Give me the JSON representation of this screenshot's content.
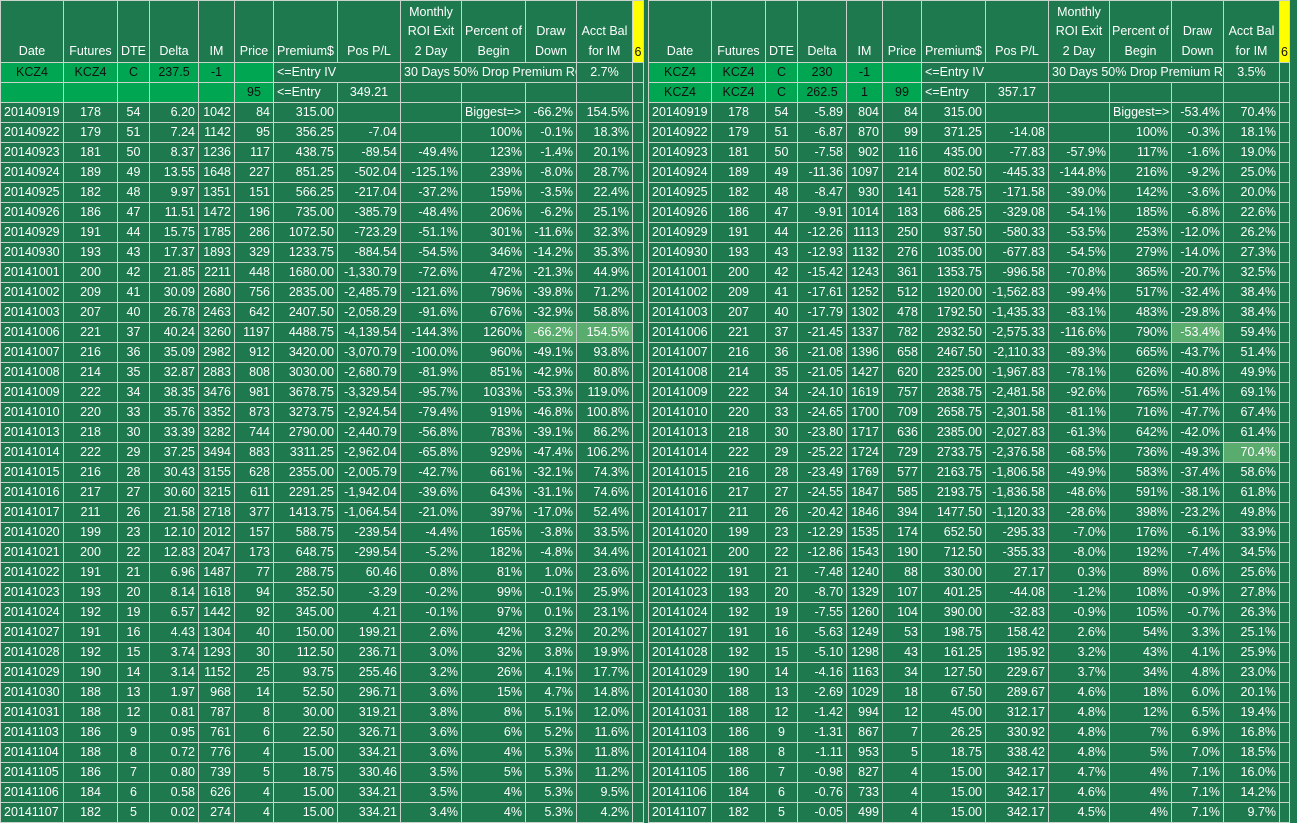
{
  "headers": [
    "Date",
    "Futures",
    "DTE",
    "Delta",
    "IM",
    "Price",
    "Premium$",
    "Pos P/L",
    "Monthly ROI Exit 2 Day",
    "Percent of Begin",
    "Draw Down",
    "Acct Bal for IM",
    "6"
  ],
  "panels": [
    {
      "entry1": [
        "KCZ4",
        "KCZ4",
        "C",
        "237.5",
        "-1"
      ],
      "entry1_note": "<=Entry IV",
      "entry1_roi_label": "30 Days 50% Drop Premium ROI=>",
      "entry1_roi": "2.7%",
      "entry2_price": "95",
      "entry2_note": "<=Entry",
      "entry2_value": "349.21",
      "rows": [
        [
          "20140919",
          "178",
          "54",
          "6.20",
          "1042",
          "84",
          "315.00",
          "",
          "",
          "Biggest=>",
          "-66.2%",
          "154.5%"
        ],
        [
          "20140922",
          "179",
          "51",
          "7.24",
          "1142",
          "95",
          "356.25",
          "-7.04",
          "",
          "100%",
          "-0.1%",
          "18.3%"
        ],
        [
          "20140923",
          "181",
          "50",
          "8.37",
          "1236",
          "117",
          "438.75",
          "-89.54",
          "-49.4%",
          "123%",
          "-1.4%",
          "20.1%"
        ],
        [
          "20140924",
          "189",
          "49",
          "13.55",
          "1648",
          "227",
          "851.25",
          "-502.04",
          "-125.1%",
          "239%",
          "-8.0%",
          "28.7%"
        ],
        [
          "20140925",
          "182",
          "48",
          "9.97",
          "1351",
          "151",
          "566.25",
          "-217.04",
          "-37.2%",
          "159%",
          "-3.5%",
          "22.4%"
        ],
        [
          "20140926",
          "186",
          "47",
          "11.51",
          "1472",
          "196",
          "735.00",
          "-385.79",
          "-48.4%",
          "206%",
          "-6.2%",
          "25.1%"
        ],
        [
          "20140929",
          "191",
          "44",
          "15.75",
          "1785",
          "286",
          "1072.50",
          "-723.29",
          "-51.1%",
          "301%",
          "-11.6%",
          "32.3%"
        ],
        [
          "20140930",
          "193",
          "43",
          "17.37",
          "1893",
          "329",
          "1233.75",
          "-884.54",
          "-54.5%",
          "346%",
          "-14.2%",
          "35.3%"
        ],
        [
          "20141001",
          "200",
          "42",
          "21.85",
          "2211",
          "448",
          "1680.00",
          "-1,330.79",
          "-72.6%",
          "472%",
          "-21.3%",
          "44.9%"
        ],
        [
          "20141002",
          "209",
          "41",
          "30.09",
          "2680",
          "756",
          "2835.00",
          "-2,485.79",
          "-121.6%",
          "796%",
          "-39.8%",
          "71.2%"
        ],
        [
          "20141003",
          "207",
          "40",
          "26.78",
          "2463",
          "642",
          "2407.50",
          "-2,058.29",
          "-91.6%",
          "676%",
          "-32.9%",
          "58.8%"
        ],
        [
          "20141006",
          "221",
          "37",
          "40.24",
          "3260",
          "1197",
          "4488.75",
          "-4,139.54",
          "-144.3%",
          "1260%",
          "-66.2%",
          "154.5%"
        ],
        [
          "20141007",
          "216",
          "36",
          "35.09",
          "2982",
          "912",
          "3420.00",
          "-3,070.79",
          "-100.0%",
          "960%",
          "-49.1%",
          "93.8%"
        ],
        [
          "20141008",
          "214",
          "35",
          "32.87",
          "2883",
          "808",
          "3030.00",
          "-2,680.79",
          "-81.9%",
          "851%",
          "-42.9%",
          "80.8%"
        ],
        [
          "20141009",
          "222",
          "34",
          "38.35",
          "3476",
          "981",
          "3678.75",
          "-3,329.54",
          "-95.7%",
          "1033%",
          "-53.3%",
          "119.0%"
        ],
        [
          "20141010",
          "220",
          "33",
          "35.76",
          "3352",
          "873",
          "3273.75",
          "-2,924.54",
          "-79.4%",
          "919%",
          "-46.8%",
          "100.8%"
        ],
        [
          "20141013",
          "218",
          "30",
          "33.39",
          "3282",
          "744",
          "2790.00",
          "-2,440.79",
          "-56.8%",
          "783%",
          "-39.1%",
          "86.2%"
        ],
        [
          "20141014",
          "222",
          "29",
          "37.25",
          "3494",
          "883",
          "3311.25",
          "-2,962.04",
          "-65.8%",
          "929%",
          "-47.4%",
          "106.2%"
        ],
        [
          "20141015",
          "216",
          "28",
          "30.43",
          "3155",
          "628",
          "2355.00",
          "-2,005.79",
          "-42.7%",
          "661%",
          "-32.1%",
          "74.3%"
        ],
        [
          "20141016",
          "217",
          "27",
          "30.60",
          "3215",
          "611",
          "2291.25",
          "-1,942.04",
          "-39.6%",
          "643%",
          "-31.1%",
          "74.6%"
        ],
        [
          "20141017",
          "211",
          "26",
          "21.58",
          "2718",
          "377",
          "1413.75",
          "-1,064.54",
          "-21.0%",
          "397%",
          "-17.0%",
          "52.4%"
        ],
        [
          "20141020",
          "199",
          "23",
          "12.10",
          "2012",
          "157",
          "588.75",
          "-239.54",
          "-4.4%",
          "165%",
          "-3.8%",
          "33.5%"
        ],
        [
          "20141021",
          "200",
          "22",
          "12.83",
          "2047",
          "173",
          "648.75",
          "-299.54",
          "-5.2%",
          "182%",
          "-4.8%",
          "34.4%"
        ],
        [
          "20141022",
          "191",
          "21",
          "6.96",
          "1487",
          "77",
          "288.75",
          "60.46",
          "0.8%",
          "81%",
          "1.0%",
          "23.6%"
        ],
        [
          "20141023",
          "193",
          "20",
          "8.14",
          "1618",
          "94",
          "352.50",
          "-3.29",
          "-0.2%",
          "99%",
          "-0.1%",
          "25.9%"
        ],
        [
          "20141024",
          "192",
          "19",
          "6.57",
          "1442",
          "92",
          "345.00",
          "4.21",
          "-0.1%",
          "97%",
          "0.1%",
          "23.1%"
        ],
        [
          "20141027",
          "191",
          "16",
          "4.43",
          "1304",
          "40",
          "150.00",
          "199.21",
          "2.6%",
          "42%",
          "3.2%",
          "20.2%"
        ],
        [
          "20141028",
          "192",
          "15",
          "3.74",
          "1293",
          "30",
          "112.50",
          "236.71",
          "3.0%",
          "32%",
          "3.8%",
          "19.9%"
        ],
        [
          "20141029",
          "190",
          "14",
          "3.14",
          "1152",
          "25",
          "93.75",
          "255.46",
          "3.2%",
          "26%",
          "4.1%",
          "17.7%"
        ],
        [
          "20141030",
          "188",
          "13",
          "1.97",
          "968",
          "14",
          "52.50",
          "296.71",
          "3.6%",
          "15%",
          "4.7%",
          "14.8%"
        ],
        [
          "20141031",
          "188",
          "12",
          "0.81",
          "787",
          "8",
          "30.00",
          "319.21",
          "3.8%",
          "8%",
          "5.1%",
          "12.0%"
        ],
        [
          "20141103",
          "186",
          "9",
          "0.95",
          "761",
          "6",
          "22.50",
          "326.71",
          "3.6%",
          "6%",
          "5.2%",
          "11.6%"
        ],
        [
          "20141104",
          "188",
          "8",
          "0.72",
          "776",
          "4",
          "15.00",
          "334.21",
          "3.6%",
          "4%",
          "5.3%",
          "11.8%"
        ],
        [
          "20141105",
          "186",
          "7",
          "0.80",
          "739",
          "5",
          "18.75",
          "330.46",
          "3.5%",
          "5%",
          "5.3%",
          "11.2%"
        ],
        [
          "20141106",
          "184",
          "6",
          "0.58",
          "626",
          "4",
          "15.00",
          "334.21",
          "3.5%",
          "4%",
          "5.3%",
          "9.5%"
        ],
        [
          "20141107",
          "182",
          "5",
          "0.02",
          "274",
          "4",
          "15.00",
          "334.21",
          "3.4%",
          "4%",
          "5.3%",
          "4.2%"
        ]
      ]
    },
    {
      "entry1": [
        "KCZ4",
        "KCZ4",
        "C",
        "230",
        "-1"
      ],
      "entry1_note": "<=Entry IV",
      "entry1_roi_label": "30 Days 50% Drop Premium ROI=>",
      "entry1_roi": "3.5%",
      "entry2": [
        "KCZ4",
        "KCZ4",
        "C",
        "262.5",
        "1"
      ],
      "entry2_price": "99",
      "entry2_note": "<=Entry",
      "entry2_value": "357.17",
      "rows": [
        [
          "20140919",
          "178",
          "54",
          "-5.89",
          "804",
          "84",
          "315.00",
          "",
          "",
          "Biggest=>",
          "-53.4%",
          "70.4%"
        ],
        [
          "20140922",
          "179",
          "51",
          "-6.87",
          "870",
          "99",
          "371.25",
          "-14.08",
          "",
          "100%",
          "-0.3%",
          "18.1%"
        ],
        [
          "20140923",
          "181",
          "50",
          "-7.58",
          "902",
          "116",
          "435.00",
          "-77.83",
          "-57.9%",
          "117%",
          "-1.6%",
          "19.0%"
        ],
        [
          "20140924",
          "189",
          "49",
          "-11.36",
          "1097",
          "214",
          "802.50",
          "-445.33",
          "-144.8%",
          "216%",
          "-9.2%",
          "25.0%"
        ],
        [
          "20140925",
          "182",
          "48",
          "-8.47",
          "930",
          "141",
          "528.75",
          "-171.58",
          "-39.0%",
          "142%",
          "-3.6%",
          "20.0%"
        ],
        [
          "20140926",
          "186",
          "47",
          "-9.91",
          "1014",
          "183",
          "686.25",
          "-329.08",
          "-54.1%",
          "185%",
          "-6.8%",
          "22.6%"
        ],
        [
          "20140929",
          "191",
          "44",
          "-12.26",
          "1113",
          "250",
          "937.50",
          "-580.33",
          "-53.5%",
          "253%",
          "-12.0%",
          "26.2%"
        ],
        [
          "20140930",
          "193",
          "43",
          "-12.93",
          "1132",
          "276",
          "1035.00",
          "-677.83",
          "-54.5%",
          "279%",
          "-14.0%",
          "27.3%"
        ],
        [
          "20141001",
          "200",
          "42",
          "-15.42",
          "1243",
          "361",
          "1353.75",
          "-996.58",
          "-70.8%",
          "365%",
          "-20.7%",
          "32.5%"
        ],
        [
          "20141002",
          "209",
          "41",
          "-17.61",
          "1252",
          "512",
          "1920.00",
          "-1,562.83",
          "-99.4%",
          "517%",
          "-32.4%",
          "38.4%"
        ],
        [
          "20141003",
          "207",
          "40",
          "-17.79",
          "1302",
          "478",
          "1792.50",
          "-1,435.33",
          "-83.1%",
          "483%",
          "-29.8%",
          "38.4%"
        ],
        [
          "20141006",
          "221",
          "37",
          "-21.45",
          "1337",
          "782",
          "2932.50",
          "-2,575.33",
          "-116.6%",
          "790%",
          "-53.4%",
          "59.4%"
        ],
        [
          "20141007",
          "216",
          "36",
          "-21.08",
          "1396",
          "658",
          "2467.50",
          "-2,110.33",
          "-89.3%",
          "665%",
          "-43.7%",
          "51.4%"
        ],
        [
          "20141008",
          "214",
          "35",
          "-21.05",
          "1427",
          "620",
          "2325.00",
          "-1,967.83",
          "-78.1%",
          "626%",
          "-40.8%",
          "49.9%"
        ],
        [
          "20141009",
          "222",
          "34",
          "-24.10",
          "1619",
          "757",
          "2838.75",
          "-2,481.58",
          "-92.6%",
          "765%",
          "-51.4%",
          "69.1%"
        ],
        [
          "20141010",
          "220",
          "33",
          "-24.65",
          "1700",
          "709",
          "2658.75",
          "-2,301.58",
          "-81.1%",
          "716%",
          "-47.7%",
          "67.4%"
        ],
        [
          "20141013",
          "218",
          "30",
          "-23.80",
          "1717",
          "636",
          "2385.00",
          "-2,027.83",
          "-61.3%",
          "642%",
          "-42.0%",
          "61.4%"
        ],
        [
          "20141014",
          "222",
          "29",
          "-25.22",
          "1724",
          "729",
          "2733.75",
          "-2,376.58",
          "-68.5%",
          "736%",
          "-49.3%",
          "70.4%"
        ],
        [
          "20141015",
          "216",
          "28",
          "-23.49",
          "1769",
          "577",
          "2163.75",
          "-1,806.58",
          "-49.9%",
          "583%",
          "-37.4%",
          "58.6%"
        ],
        [
          "20141016",
          "217",
          "27",
          "-24.55",
          "1847",
          "585",
          "2193.75",
          "-1,836.58",
          "-48.6%",
          "591%",
          "-38.1%",
          "61.8%"
        ],
        [
          "20141017",
          "211",
          "26",
          "-20.42",
          "1846",
          "394",
          "1477.50",
          "-1,120.33",
          "-28.6%",
          "398%",
          "-23.2%",
          "49.8%"
        ],
        [
          "20141020",
          "199",
          "23",
          "-12.29",
          "1535",
          "174",
          "652.50",
          "-295.33",
          "-7.0%",
          "176%",
          "-6.1%",
          "33.9%"
        ],
        [
          "20141021",
          "200",
          "22",
          "-12.86",
          "1543",
          "190",
          "712.50",
          "-355.33",
          "-8.0%",
          "192%",
          "-7.4%",
          "34.5%"
        ],
        [
          "20141022",
          "191",
          "21",
          "-7.48",
          "1240",
          "88",
          "330.00",
          "27.17",
          "0.3%",
          "89%",
          "0.6%",
          "25.6%"
        ],
        [
          "20141023",
          "193",
          "20",
          "-8.70",
          "1329",
          "107",
          "401.25",
          "-44.08",
          "-1.2%",
          "108%",
          "-0.9%",
          "27.8%"
        ],
        [
          "20141024",
          "192",
          "19",
          "-7.55",
          "1260",
          "104",
          "390.00",
          "-32.83",
          "-0.9%",
          "105%",
          "-0.7%",
          "26.3%"
        ],
        [
          "20141027",
          "191",
          "16",
          "-5.63",
          "1249",
          "53",
          "198.75",
          "158.42",
          "2.6%",
          "54%",
          "3.3%",
          "25.1%"
        ],
        [
          "20141028",
          "192",
          "15",
          "-5.10",
          "1298",
          "43",
          "161.25",
          "195.92",
          "3.2%",
          "43%",
          "4.1%",
          "25.9%"
        ],
        [
          "20141029",
          "190",
          "14",
          "-4.16",
          "1163",
          "34",
          "127.50",
          "229.67",
          "3.7%",
          "34%",
          "4.8%",
          "23.0%"
        ],
        [
          "20141030",
          "188",
          "13",
          "-2.69",
          "1029",
          "18",
          "67.50",
          "289.67",
          "4.6%",
          "18%",
          "6.0%",
          "20.1%"
        ],
        [
          "20141031",
          "188",
          "12",
          "-1.42",
          "994",
          "12",
          "45.00",
          "312.17",
          "4.8%",
          "12%",
          "6.5%",
          "19.4%"
        ],
        [
          "20141103",
          "186",
          "9",
          "-1.31",
          "867",
          "7",
          "26.25",
          "330.92",
          "4.8%",
          "7%",
          "6.9%",
          "16.8%"
        ],
        [
          "20141104",
          "188",
          "8",
          "-1.11",
          "953",
          "5",
          "18.75",
          "338.42",
          "4.8%",
          "5%",
          "7.0%",
          "18.5%"
        ],
        [
          "20141105",
          "186",
          "7",
          "-0.98",
          "827",
          "4",
          "15.00",
          "342.17",
          "4.7%",
          "4%",
          "7.1%",
          "16.0%"
        ],
        [
          "20141106",
          "184",
          "6",
          "-0.76",
          "733",
          "4",
          "15.00",
          "342.17",
          "4.6%",
          "4%",
          "7.1%",
          "14.2%"
        ],
        [
          "20141107",
          "182",
          "5",
          "-0.05",
          "499",
          "4",
          "15.00",
          "342.17",
          "4.5%",
          "4%",
          "7.1%",
          "9.7%"
        ]
      ]
    }
  ]
}
